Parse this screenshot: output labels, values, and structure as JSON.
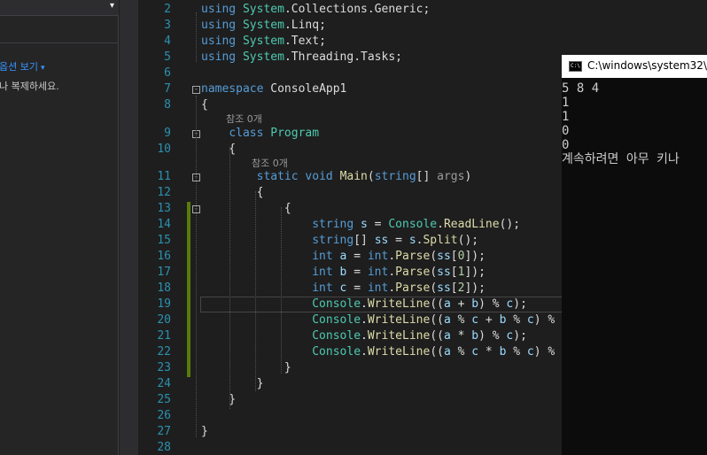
{
  "left_panel": {
    "dropdown_caret": "▾",
    "link_text": "옵션 보기",
    "link_caret": "▾",
    "hint_text": "나 복제하세요."
  },
  "editor": {
    "lines": [
      {
        "n": "2",
        "tokens": [
          [
            "kw",
            "using"
          ],
          [
            "",
            "  "
          ],
          [
            "ty",
            "System"
          ],
          [
            "",
            ".Collections.Generic;"
          ]
        ]
      },
      {
        "n": "3",
        "tokens": [
          [
            "kw",
            "using"
          ],
          [
            "",
            " "
          ],
          [
            "ty",
            "System"
          ],
          [
            "",
            ".Linq;"
          ]
        ]
      },
      {
        "n": "4",
        "tokens": [
          [
            "kw",
            "using"
          ],
          [
            "",
            " "
          ],
          [
            "ty",
            "System"
          ],
          [
            "",
            ".Text;"
          ]
        ]
      },
      {
        "n": "5",
        "tokens": [
          [
            "kw",
            "using"
          ],
          [
            "",
            " "
          ],
          [
            "ty",
            "System"
          ],
          [
            "",
            ".Threading.Tasks;"
          ]
        ]
      }
    ],
    "ref_hint_1": "참조 0개",
    "ref_hint_2": "참조 0개"
  },
  "console": {
    "title": "C:\\windows\\system32\\",
    "output": [
      "5 8 4",
      "1",
      "1",
      "0",
      "0",
      "계속하려면 아무 키나"
    ]
  }
}
